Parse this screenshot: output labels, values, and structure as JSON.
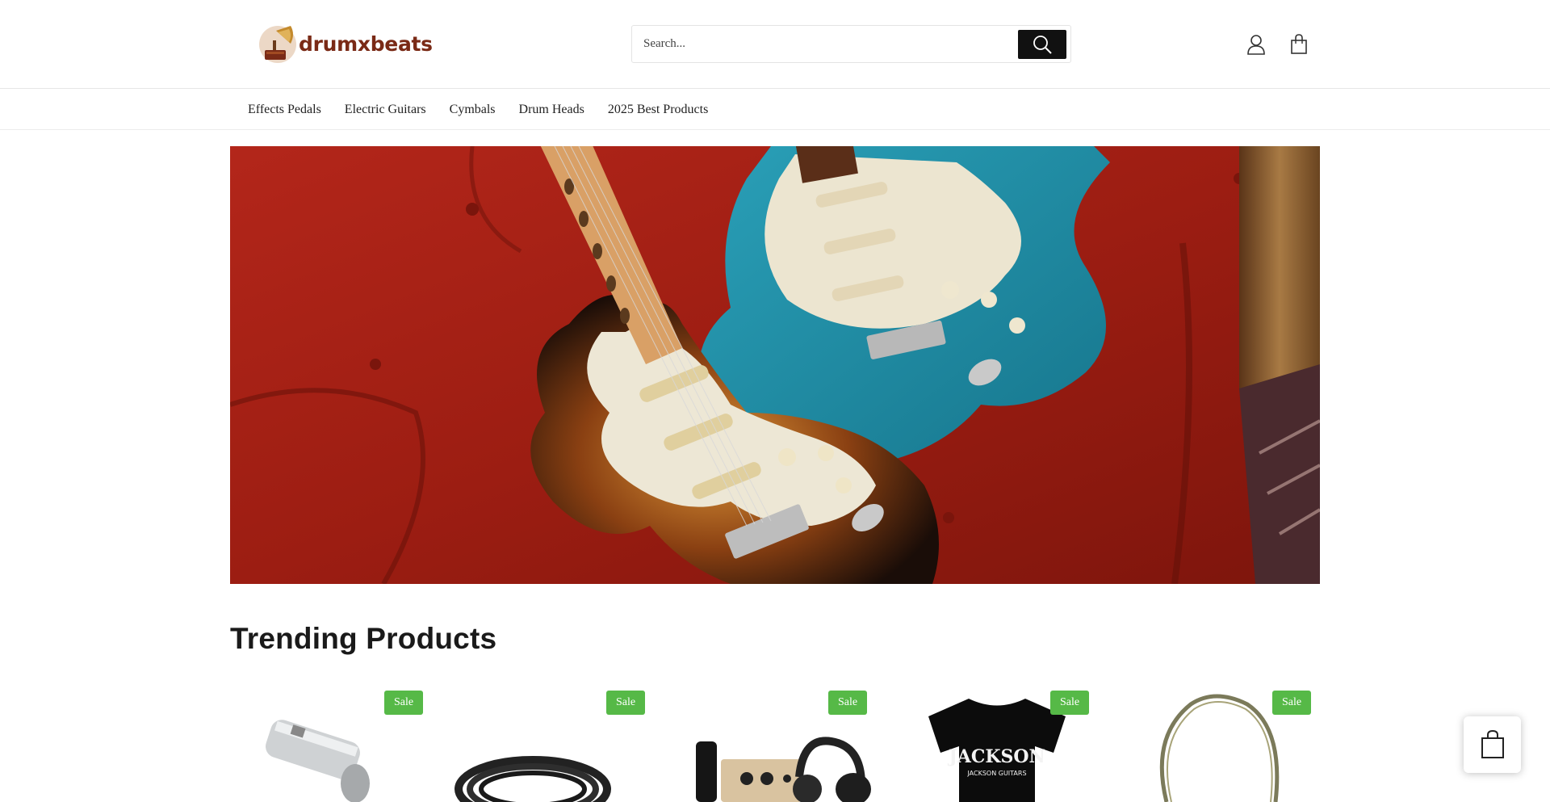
{
  "header": {
    "logo_text": "drumxbeats",
    "search": {
      "placeholder": "Search..."
    },
    "icons": [
      "search-icon",
      "account-icon",
      "cart-icon"
    ]
  },
  "nav": {
    "items": [
      {
        "label": "Effects Pedals"
      },
      {
        "label": "Electric Guitars"
      },
      {
        "label": "Cymbals"
      },
      {
        "label": "Drum Heads"
      },
      {
        "label": "2025 Best Products"
      }
    ]
  },
  "hero": {
    "image": "two electric guitars on red sofa"
  },
  "trending": {
    "title": "Trending Products",
    "products": [
      {
        "badge": "Sale",
        "image": "xlr adapter"
      },
      {
        "badge": "Sale",
        "image": "coiled cable"
      },
      {
        "badge": "Sale",
        "image": "recording bundle"
      },
      {
        "badge": "Sale",
        "image": "band t-shirt"
      },
      {
        "badge": "Sale",
        "image": "braided strap"
      }
    ]
  },
  "colors": {
    "logo": "#7a2a16",
    "sale_badge": "#56b947",
    "search_button": "#111111",
    "hero_sofa": "#a11f14",
    "guitar_teal": "#1f8fa6"
  }
}
